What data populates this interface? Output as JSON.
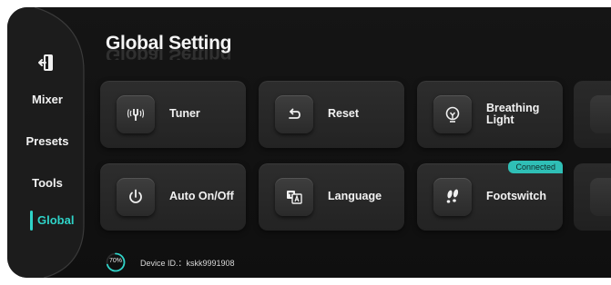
{
  "app": {
    "title": "Global Setting"
  },
  "colors": {
    "accent": "#2fd3c8",
    "badge": "#2fbfb6",
    "background": "#131313",
    "card": "#2a2a2a"
  },
  "sidebar": {
    "items": [
      {
        "id": "exit",
        "icon": "exit-door-icon"
      },
      {
        "id": "mixer",
        "label": "Mixer"
      },
      {
        "id": "presets",
        "label": "Presets"
      },
      {
        "id": "tools",
        "label": "Tools"
      },
      {
        "id": "global",
        "label": "Global",
        "active": true
      }
    ]
  },
  "cards": [
    {
      "id": "tuner",
      "label": "Tuner",
      "icon": "tuner-fork-icon"
    },
    {
      "id": "reset",
      "label": "Reset",
      "icon": "undo-arrow-icon"
    },
    {
      "id": "breathing-light",
      "label": "Breathing\nLight",
      "icon": "lightbulb-icon"
    },
    {
      "id": "auto-onoff",
      "label": "Auto On/Off",
      "icon": "power-icon"
    },
    {
      "id": "language",
      "label": "Language",
      "icon": "translate-icon"
    },
    {
      "id": "footswitch",
      "label": "Footswitch",
      "icon": "footprint-icon",
      "badge": "Connected"
    }
  ],
  "status": {
    "battery": "70%",
    "battery_level": 0.7,
    "device_id": "Device ID.：kskk9991908"
  }
}
